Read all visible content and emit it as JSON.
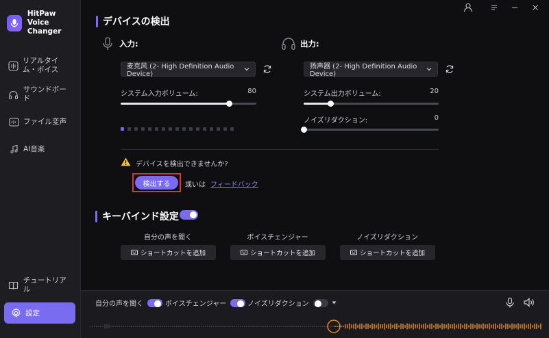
{
  "app": {
    "brand_line1": "HitPaw",
    "brand_line2": "Voice Changer"
  },
  "sidebar": {
    "items": [
      {
        "label": "リアルタイム・ボイス",
        "icon": "waveform-icon"
      },
      {
        "label": "サウンドボード",
        "icon": "headphones-icon"
      },
      {
        "label": "ファイル変声",
        "icon": "file-audio-icon"
      },
      {
        "label": "AI音楽",
        "icon": "ai-music-icon"
      }
    ],
    "tutorial_label": "チュートリアル",
    "settings_label": "設定"
  },
  "device_section": {
    "title": "デバイスの検出",
    "input": {
      "heading": "入力:",
      "device": "麦克风 (2- High Definition Audio Device)",
      "volume_label": "システム入力ボリューム:",
      "volume_value": "80",
      "volume_level": 80,
      "meter_level": 1
    },
    "output": {
      "heading": "出力:",
      "device": "扬声器 (2- High Definition Audio Device)",
      "volume_label": "システム出力ボリューム:",
      "volume_value": "20",
      "volume_level": 20,
      "noise_label": "ノイズリダクション:",
      "noise_value": "0",
      "noise_level": 0
    },
    "warning_text": "デバイスを検出できませんか?",
    "detect_button": "検出する",
    "or_text": "或いは",
    "feedback_link": "フィードバック"
  },
  "keybind_section": {
    "title": "キーバインド設定",
    "enabled": true,
    "columns": [
      {
        "label": "自分の声を聞く",
        "button": "ショートカットを追加"
      },
      {
        "label": "ボイスチェンジャー",
        "button": "ショートカットを追加"
      },
      {
        "label": "ノイズリダクション",
        "button": "ショートカットを追加"
      }
    ]
  },
  "footer": {
    "hear_self_label": "自分の声を聞く",
    "hear_self_on": true,
    "voice_changer_label": "ボイスチェンジャー",
    "voice_changer_on": true,
    "noise_label": "ノイズリダクション",
    "noise_on": false
  },
  "colors": {
    "accent": "#7a6cf0",
    "highlight_border": "#e63131",
    "wave": "#e08a2a"
  }
}
